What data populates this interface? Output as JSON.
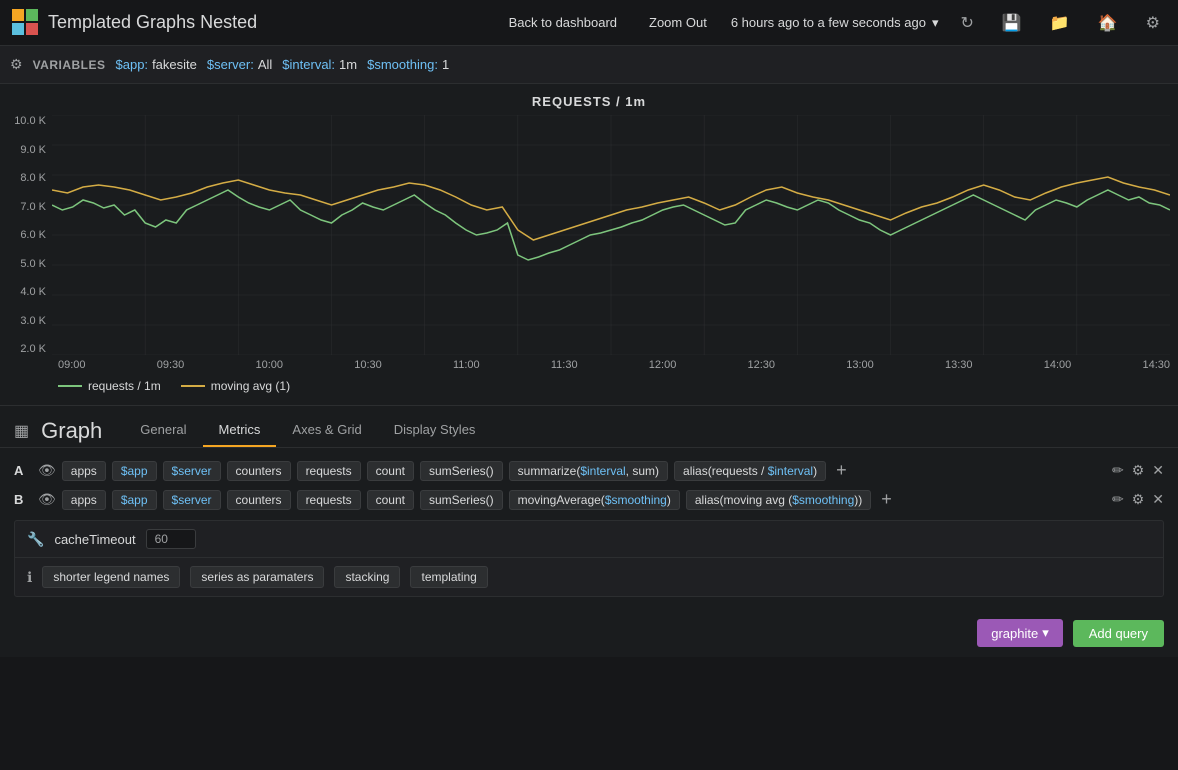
{
  "topnav": {
    "title": "Templated Graphs Nested",
    "back_label": "Back to dashboard",
    "zoom_out_label": "Zoom Out",
    "time_range": "6 hours ago to a few seconds ago",
    "icons": [
      "refresh-icon",
      "save-icon",
      "folder-icon",
      "home-icon",
      "settings-icon"
    ]
  },
  "variables": {
    "label": "VARIABLES",
    "items": [
      {
        "name": "$app:",
        "value": "fakesite"
      },
      {
        "name": "$server:",
        "value": "All"
      },
      {
        "name": "$interval:",
        "value": "1m"
      },
      {
        "name": "$smoothing:",
        "value": "1"
      }
    ]
  },
  "chart": {
    "title": "REQUESTS / 1m",
    "y_labels": [
      "10.0 K",
      "9.0 K",
      "8.0 K",
      "7.0 K",
      "6.0 K",
      "5.0 K",
      "4.0 K",
      "3.0 K",
      "2.0 K"
    ],
    "x_labels": [
      "09:00",
      "09:30",
      "10:00",
      "10:30",
      "11:00",
      "11:30",
      "12:00",
      "12:30",
      "13:00",
      "13:30",
      "14:00",
      "14:30"
    ],
    "legend": [
      {
        "label": "requests / 1m",
        "color": "#7dc57d"
      },
      {
        "label": "moving avg (1)",
        "color": "#d4ac45"
      }
    ]
  },
  "graph_panel": {
    "title": "Graph",
    "tabs": [
      "General",
      "Metrics",
      "Axes & Grid",
      "Display Styles"
    ],
    "active_tab": "Metrics"
  },
  "queries": [
    {
      "id": "A",
      "parts": [
        "apps",
        "$app",
        "$server",
        "counters",
        "requests",
        "count",
        "sumSeries()",
        "summarize($interval, sum)",
        "alias(requests / $interval)"
      ],
      "app_var": "$app",
      "server_var": "$server",
      "interval_var": "$interval"
    },
    {
      "id": "B",
      "parts": [
        "apps",
        "$app",
        "$server",
        "counters",
        "requests",
        "count",
        "sumSeries()",
        "movingAverage($smoothing)",
        "alias(moving avg ($smoothing))"
      ],
      "app_var": "$app",
      "server_var": "$server",
      "smoothing_var": "$smoothing"
    }
  ],
  "options": {
    "cache_timeout_label": "cacheTimeout",
    "cache_timeout_value": "60",
    "info_items": [
      "shorter legend names",
      "series as paramaters",
      "stacking",
      "templating"
    ]
  },
  "bottom": {
    "graphite_label": "graphite",
    "add_query_label": "Add query",
    "dropdown_arrow": "▾"
  }
}
